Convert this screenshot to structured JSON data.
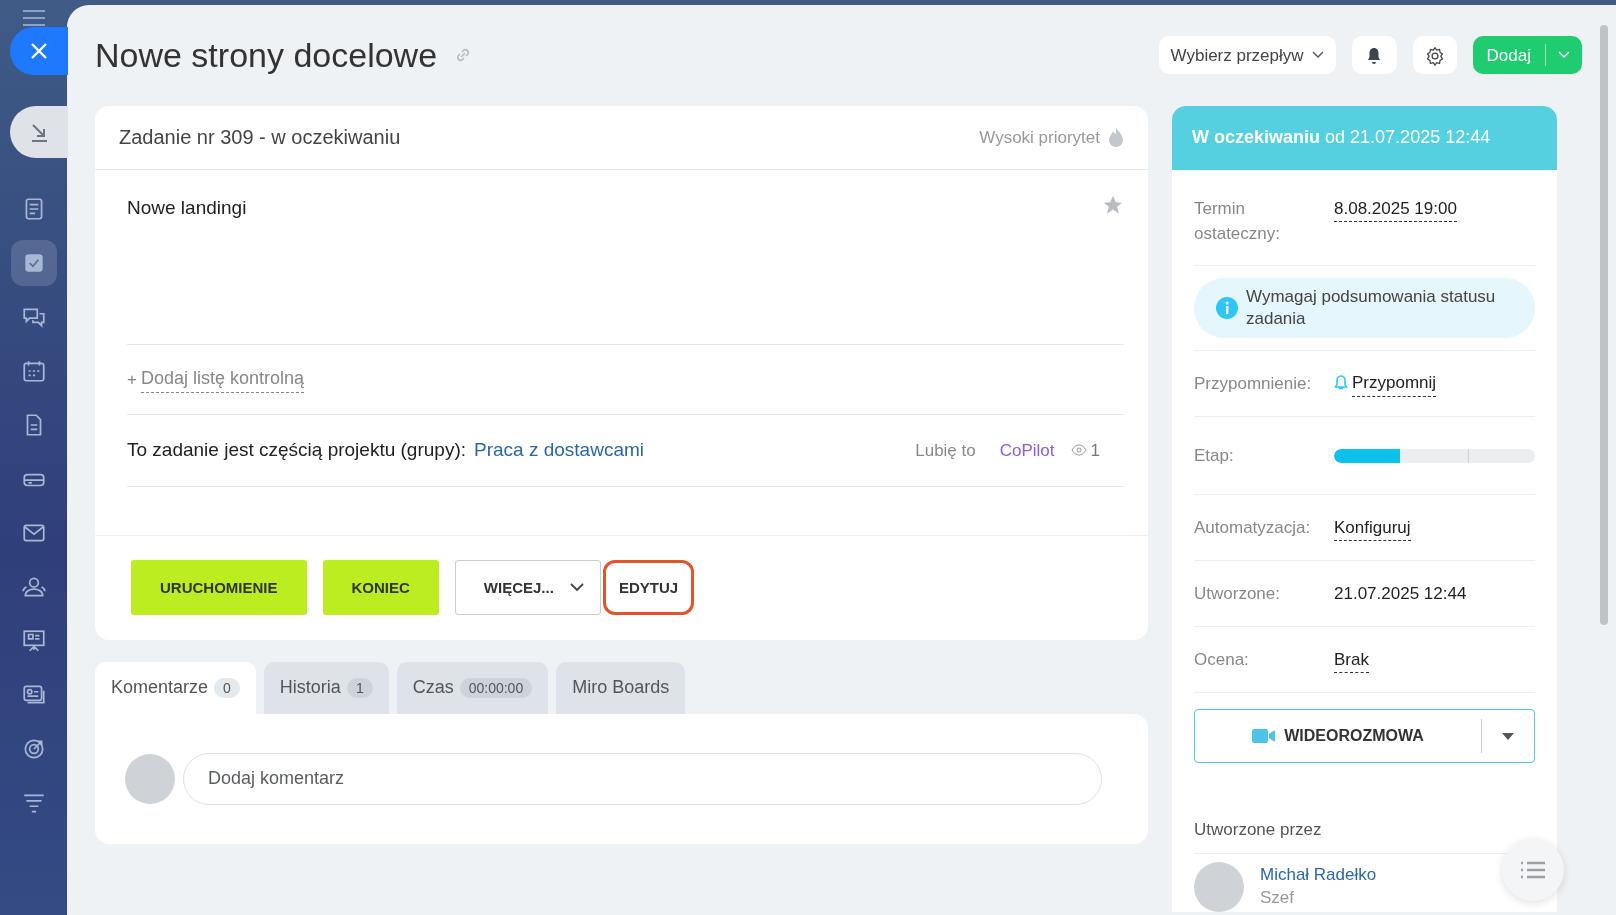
{
  "sidebar": {
    "items": [
      {
        "selected": false
      },
      {
        "selected": true
      },
      {
        "selected": false
      },
      {
        "selected": false
      },
      {
        "selected": false
      },
      {
        "selected": false
      },
      {
        "selected": false
      },
      {
        "selected": false
      },
      {
        "selected": false
      },
      {
        "selected": false
      },
      {
        "selected": false
      },
      {
        "selected": false
      }
    ]
  },
  "header": {
    "title": "Nowe strony docelowe",
    "flow_select": "Wybierz przepływ",
    "add_button": "Dodaj"
  },
  "task": {
    "title": "Zadanie nr 309 - w oczekiwaniu",
    "priority": "Wysoki priorytet",
    "favorite": false,
    "description": "Nowe landingi",
    "checklist_prefix": "+",
    "checklist_link": "Dodaj listę kontrolną",
    "project_label": "To zadanie jest częścią projektu (grupy):",
    "project_link": "Praca z dostawcami",
    "like": "Lubię to",
    "copilot": "CoPilot",
    "views": "1",
    "actions": [
      {
        "label": "URUCHOMIENIE",
        "kind": "primary"
      },
      {
        "label": "KONIEC",
        "kind": "primary"
      },
      {
        "label": "WIĘCEJ...",
        "kind": "dropdown"
      },
      {
        "label": "EDYTUJ",
        "kind": "highlighted"
      }
    ]
  },
  "tabs": [
    {
      "label": "Komentarze",
      "count": "0",
      "selected": true
    },
    {
      "label": "Historia",
      "count": "1",
      "selected": false
    },
    {
      "label": "Czas",
      "count": "00:00:00",
      "selected": false
    },
    {
      "label": "Miro Boards",
      "selected": false
    }
  ],
  "comment": {
    "placeholder": "Dodaj komentarz"
  },
  "status": {
    "state": "W oczekiwaniu",
    "since": "od 21.07.2025 12:44"
  },
  "details": [
    {
      "kind": "link",
      "label": "Termin ostateczny:",
      "value": "8.08.2025 19:00"
    },
    {
      "kind": "notice",
      "value": "Wymagaj podsumowania statusu zadania"
    },
    {
      "kind": "reminder",
      "label": "Przypomnienie:",
      "value": "Przypomnij"
    },
    {
      "kind": "stage",
      "label": "Etap:",
      "level": 0.33
    },
    {
      "kind": "plainlink",
      "label": "Automatyzacja:",
      "value": "Konfiguruj"
    },
    {
      "kind": "text",
      "label": "Utworzone:",
      "value": "21.07.2025 12:44"
    },
    {
      "kind": "plainlink",
      "label": "Ocena:",
      "value": "Brak"
    }
  ],
  "video_button": "WIDEOROZMOWA",
  "created_by": {
    "heading": "Utworzone przez",
    "name": "Michał Radełko",
    "role": "Szef"
  }
}
